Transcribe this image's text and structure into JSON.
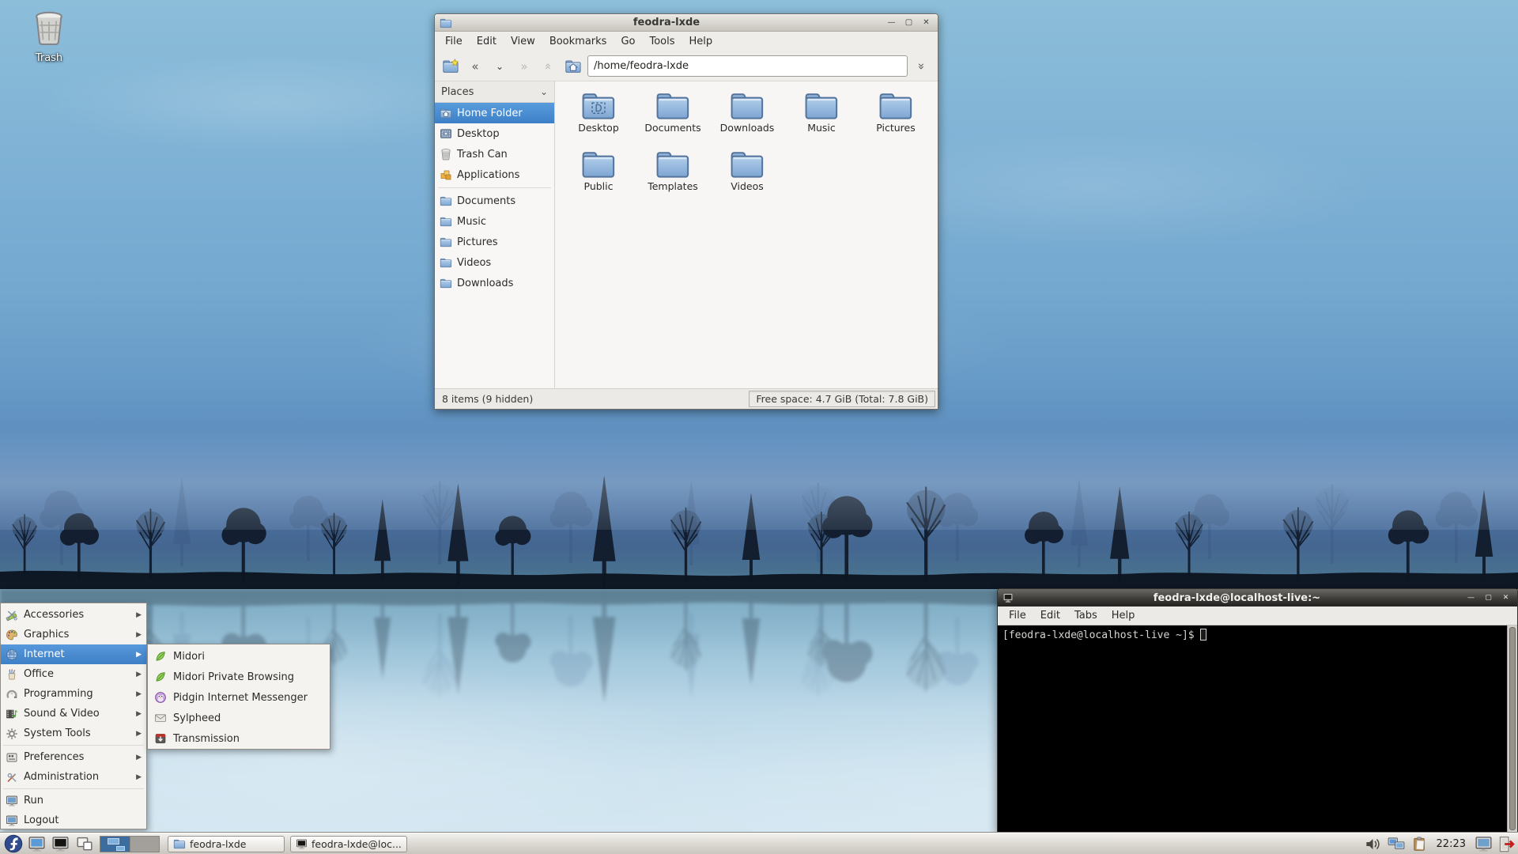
{
  "colors": {
    "selection_blue": "#4a90d2",
    "titlebar_active_dark": "#3d3c39",
    "titlebar_inactive_light": "#d3d0ca",
    "taskbar_bg": "#d8d5cf",
    "terminal_bg": "#000000",
    "terminal_fg": "#d3d7cf",
    "folder_blue": "#7fa7d3",
    "sky_blue": "#7fb2d5"
  },
  "icons": {
    "minimize": "—",
    "maximize": "▢",
    "close": "✕",
    "back": "«",
    "forward": "»",
    "history_down": "⌄",
    "up_arrow": "«",
    "go_down": "»",
    "places_chevron": "⌄",
    "submenu_arrow": "▶"
  },
  "desktop": {
    "trash_label": "Trash"
  },
  "file_manager": {
    "title": "feodra-lxde",
    "menu": [
      "File",
      "Edit",
      "View",
      "Bookmarks",
      "Go",
      "Tools",
      "Help"
    ],
    "path": "/home/feodra-lxde",
    "places_header": "Places",
    "places": [
      {
        "label": "Home Folder",
        "selected": true
      },
      {
        "label": "Desktop"
      },
      {
        "label": "Trash Can"
      },
      {
        "label": "Applications"
      },
      {
        "label": "Documents"
      },
      {
        "label": "Music"
      },
      {
        "label": "Pictures"
      },
      {
        "label": "Videos"
      },
      {
        "label": "Downloads"
      }
    ],
    "folders": [
      "Desktop",
      "Documents",
      "Downloads",
      "Music",
      "Pictures",
      "Public",
      "Templates",
      "Videos"
    ],
    "status_left": "8 items (9 hidden)",
    "status_right": "Free space: 4.7 GiB (Total: 7.8 GiB)"
  },
  "terminal": {
    "title": "feodra-lxde@localhost-live:~",
    "menu": [
      "File",
      "Edit",
      "Tabs",
      "Help"
    ],
    "prompt": "[feodra-lxde@localhost-live ~]$"
  },
  "app_menu": {
    "items": [
      {
        "label": "Accessories",
        "submenu": true
      },
      {
        "label": "Graphics",
        "submenu": true
      },
      {
        "label": "Internet",
        "submenu": true,
        "highlighted": true
      },
      {
        "label": "Office",
        "submenu": true
      },
      {
        "label": "Programming",
        "submenu": true
      },
      {
        "label": "Sound & Video",
        "submenu": true
      },
      {
        "label": "System Tools",
        "submenu": true
      },
      {
        "label": "Preferences",
        "submenu": true
      },
      {
        "label": "Administration",
        "submenu": true
      },
      {
        "label": "Run",
        "submenu": false
      },
      {
        "label": "Logout",
        "submenu": false
      }
    ],
    "internet_submenu": [
      "Midori",
      "Midori Private Browsing",
      "Pidgin Internet Messenger",
      "Sylpheed",
      "Transmission"
    ]
  },
  "taskbar": {
    "task_buttons": [
      "feodra-lxde",
      "feodra-lxde@loc..."
    ],
    "clock": "22:23"
  }
}
